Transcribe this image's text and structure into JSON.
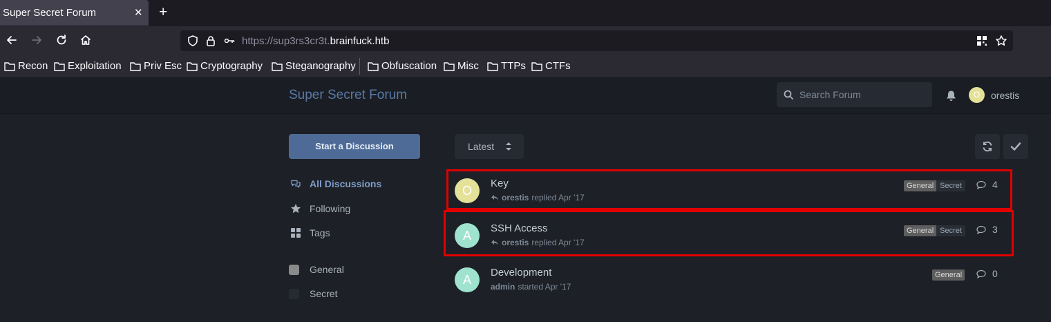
{
  "browser": {
    "tab_title": "Super Secret Forum",
    "tab_close": "✕",
    "new_tab": "+",
    "url_prefix": "https://sup3rs3cr3t.",
    "url_domain": "brainfuck.htb",
    "bookmarks": [
      "Recon",
      "Exploitation",
      "Priv Esc",
      "Cryptography",
      "Steganography",
      "Obfuscation",
      "Misc",
      "TTPs",
      "CTFs"
    ]
  },
  "forum": {
    "title": "Super Secret Forum",
    "search_placeholder": "Search Forum",
    "user_initial": "O",
    "username": "orestis",
    "start_button": "Start a Discussion",
    "nav": [
      "All Discussions",
      "Following",
      "Tags"
    ],
    "tags": [
      {
        "label": "General",
        "color": "#8a8a8a"
      },
      {
        "label": "Secret",
        "color": "#262a31"
      }
    ],
    "sort_label": "Latest",
    "discussions": [
      {
        "initial": "O",
        "avatar_color": "#e4e199",
        "title": "Key",
        "user": "orestis",
        "action": "replied Apr '17",
        "tags": [
          "General",
          "Secret"
        ],
        "count": "4",
        "reply_icon": true
      },
      {
        "initial": "A",
        "avatar_color": "#9fe3cf",
        "title": "SSH Access",
        "user": "orestis",
        "action": "replied Apr '17",
        "tags": [
          "General",
          "Secret"
        ],
        "count": "3",
        "reply_icon": true
      },
      {
        "initial": "A",
        "avatar_color": "#9fe3cf",
        "title": "Development",
        "user": "admin",
        "action": "started Apr '17",
        "tags": [
          "General"
        ],
        "count": "0",
        "reply_icon": false
      }
    ],
    "highlight_color": "#e00000"
  }
}
